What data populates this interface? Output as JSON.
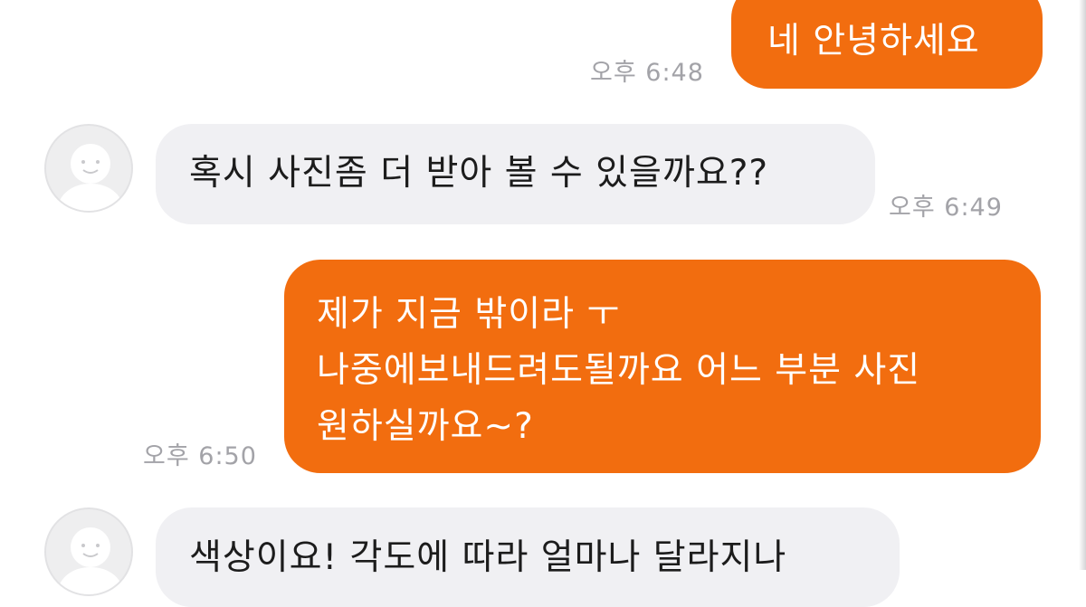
{
  "messages": [
    {
      "direction": "out",
      "text": "네 안녕하세요",
      "time": "오후 6:48"
    },
    {
      "direction": "in",
      "text": "혹시 사진좀 더 받아 볼 수 있을까요??",
      "time": "오후 6:49"
    },
    {
      "direction": "out",
      "lines": [
        "제가 지금 밖이라 ㅜ",
        "나중에보내드려도될까요 어느 부분 사진",
        "원하실까요~?"
      ],
      "time": "오후 6:50"
    },
    {
      "direction": "in",
      "text": "색상이요! 각도에 따라 얼마나 달라지나"
    }
  ],
  "colors": {
    "outgoing_bubble": "#f26d0f",
    "incoming_bubble": "#f0f0f3",
    "timestamp": "#a3a3a8"
  },
  "icons": {
    "avatar": "default-profile-icon"
  }
}
